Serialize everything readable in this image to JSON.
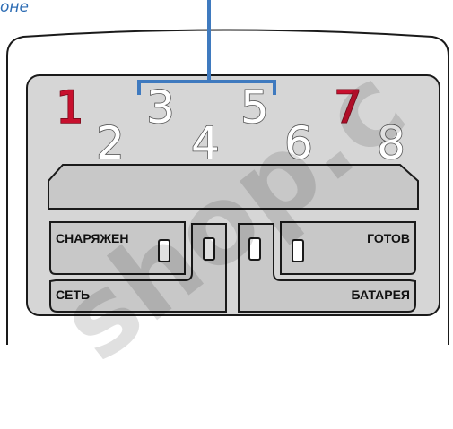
{
  "caption": "оне",
  "digits": [
    "1",
    "2",
    "3",
    "4",
    "5",
    "6",
    "7",
    "8"
  ],
  "panel": {
    "left_label_top": "СНАРЯЖЕН",
    "left_label_bottom": "СЕТЬ",
    "right_label_top": "ГОТОВ",
    "right_label_bottom": "БАТАРЕЯ"
  },
  "watermark": "shop.c",
  "colors": {
    "bracket": "#3f7abf",
    "red_digits": "#c8102e",
    "panel_fill": "#d6d6d6",
    "key_fill": "#c8c8c8",
    "outline": "#1a1a1a"
  }
}
